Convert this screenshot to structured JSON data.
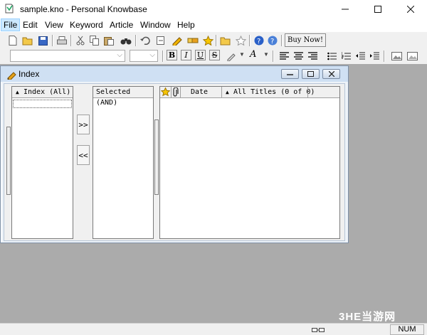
{
  "window": {
    "title": "sample.kno - Personal Knowbase"
  },
  "menu": [
    "File",
    "Edit",
    "View",
    "Keyword",
    "Article",
    "Window",
    "Help"
  ],
  "toolbar": {
    "buy_label": "Buy Now!"
  },
  "format": {
    "bold": "B",
    "italic": "I",
    "underline": "U",
    "strike": "S",
    "font_color": "A"
  },
  "index_window": {
    "title": "Index",
    "index_header": "Index (All)",
    "selected_header": "Selected (AND)",
    "date_header": "Date",
    "titles_header": "All Titles (0 of 0)",
    "add_button": ">>",
    "remove_button": "<<"
  },
  "status": {
    "num": "NUM"
  },
  "watermark": "3HE当游网",
  "colors": {
    "mdi_bg": "#ababab",
    "child_title": "#cfe0f3",
    "menu_highlight": "#cce8ff"
  }
}
